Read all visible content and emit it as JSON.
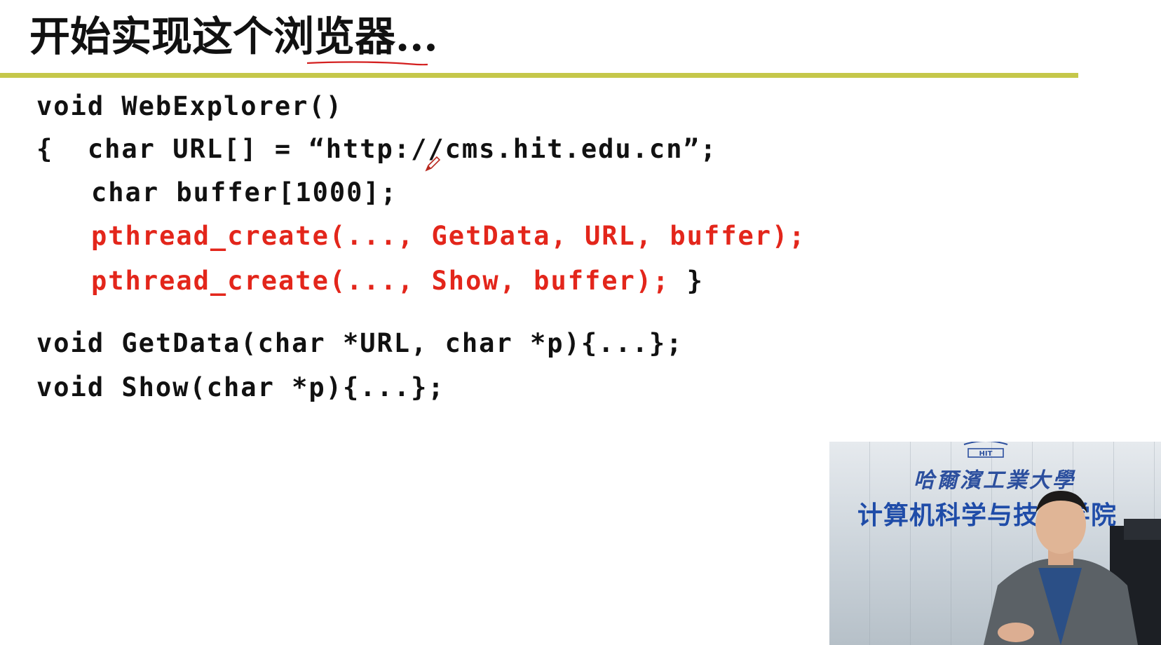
{
  "slide": {
    "title": "开始实现这个浏览器...",
    "accent_color": "#c5c74a",
    "code_color": "#111111",
    "highlight_color": "#e3261b"
  },
  "code": {
    "line1": "void WebExplorer()",
    "line2": "{  char URL[] = “http://cms.hit.edu.cn”;",
    "line3": "char buffer[1000];",
    "line4": "pthread_create(..., GetData, URL, buffer);",
    "line5_red": "pthread_create(..., Show, buffer);",
    "line5_tail": " }",
    "line6": "void GetData(char *URL, char *p){...};",
    "line7": "void Show(char *p){...};"
  },
  "video": {
    "logo_text": "HIT",
    "calligraphy": "哈爾濱工業大學",
    "department": "计算机科学与技术学院"
  },
  "icons": {
    "pen_cursor": "pen-cursor-icon",
    "university_logo": "university-logo-icon"
  }
}
